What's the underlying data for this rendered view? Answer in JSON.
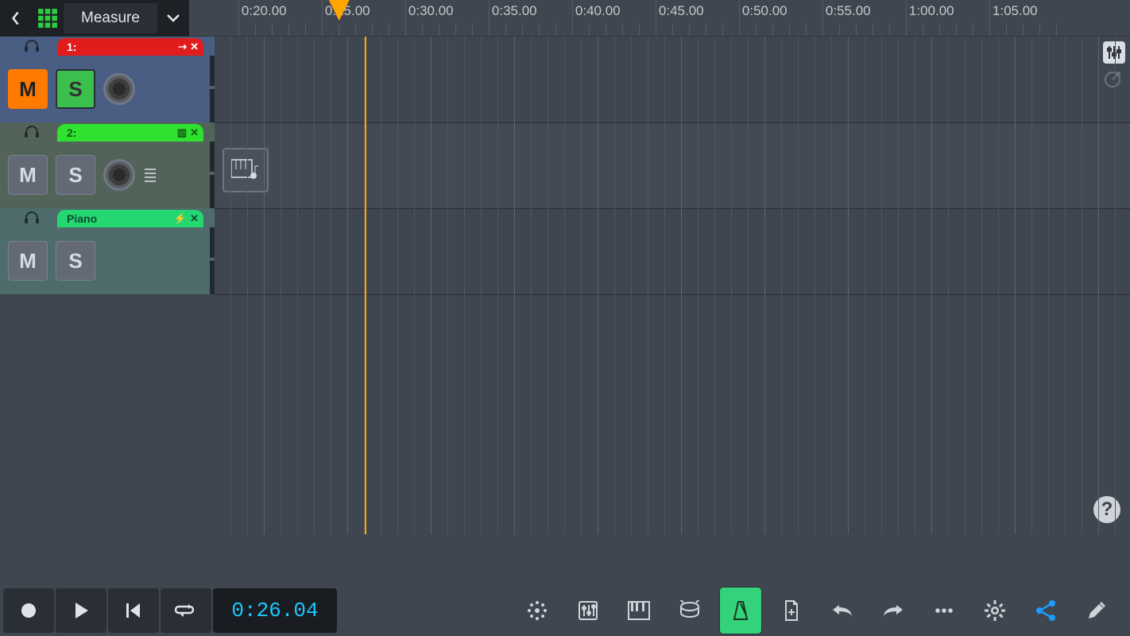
{
  "top": {
    "mode_label": "Measure",
    "ruler_ticks": [
      "0:20.00",
      "0:25.00",
      "0:30.00",
      "0:35.00",
      "0:40.00",
      "0:45.00",
      "0:50.00",
      "0:55.00",
      "1:00.00",
      "1:05.00"
    ]
  },
  "playhead_position_label": "0:25.00",
  "tracks": [
    {
      "number_label": "1:",
      "name": "",
      "mute_label": "M",
      "solo_label": "S",
      "mute_on": true,
      "type_icon": "audio-wave-icon"
    },
    {
      "number_label": "2:",
      "name": "",
      "mute_label": "M",
      "solo_label": "S",
      "mute_on": false,
      "type_icon": "piano-keys-icon"
    },
    {
      "number_label": "",
      "name": "Piano",
      "mute_label": "M",
      "solo_label": "S",
      "mute_on": false,
      "type_icon": "plug-icon"
    }
  ],
  "transport": {
    "time_display": "0:26.04"
  },
  "bottom_tools": {
    "metronome_active": true
  },
  "help_label": "?"
}
